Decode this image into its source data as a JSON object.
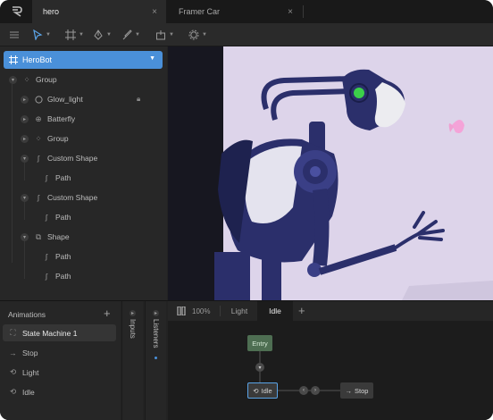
{
  "tabs": [
    {
      "label": "hero",
      "close": "×"
    },
    {
      "label": "Framer Car",
      "close": "×"
    }
  ],
  "toolbar": {
    "icons": [
      "menu-icon",
      "pointer-icon",
      "artboard-icon",
      "pen-icon",
      "brush-icon",
      "bone-icon",
      "settings-icon"
    ]
  },
  "hierarchy": {
    "artboard": "HeroBot",
    "items": [
      {
        "label": "Group"
      },
      {
        "label": "Glow_light"
      },
      {
        "label": "Batterfly"
      },
      {
        "label": "Group"
      },
      {
        "label": "Custom Shape"
      },
      {
        "label": "Path"
      },
      {
        "label": "Custom Shape"
      },
      {
        "label": "Path"
      },
      {
        "label": "Shape"
      },
      {
        "label": "Path"
      },
      {
        "label": "Path"
      }
    ]
  },
  "animations": {
    "title": "Animations",
    "add": "+",
    "items": [
      {
        "label": "State Machine 1",
        "selected": true
      },
      {
        "label": "Stop"
      },
      {
        "label": "Light"
      },
      {
        "label": "Idle"
      }
    ]
  },
  "side_tabs": {
    "inputs": "Inputs",
    "listeners": "Listeners"
  },
  "state_machine": {
    "zoom": "100%",
    "tabs": [
      "Light",
      "Idle"
    ],
    "active_tab": "Idle",
    "add": "+",
    "nodes": {
      "entry": "Entry",
      "idle": "Idle",
      "stop": "Stop"
    }
  },
  "colors": {
    "accent": "#4a90d9",
    "entry_node": "#4e6e52",
    "robot_body": "#2b2f6b",
    "canvas_bg": "#ded6eb"
  }
}
